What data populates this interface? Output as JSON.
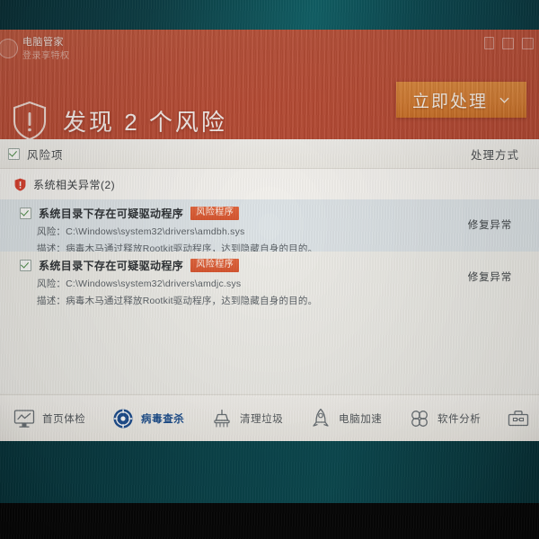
{
  "window": {
    "brand_name": "电脑管家",
    "brand_sub": "登录享特权",
    "controls": [
      "minimize-icon",
      "maximize-icon",
      "close-icon"
    ]
  },
  "header": {
    "shield_icon": "shield-warning-icon",
    "alert_title": "发现 2 个风险",
    "action_button": {
      "label": "立即处理",
      "dropdown_icon": "chevron-down-icon",
      "color": "#d97f33"
    },
    "background_color": "#bd4e36"
  },
  "list_header": {
    "select_all_checked": true,
    "left_label": "风险项",
    "right_label": "处理方式"
  },
  "group": {
    "icon": "shield-alert-icon",
    "label": "系统相关异常(2)",
    "count": 2
  },
  "risks": [
    {
      "checked": true,
      "name": "系统目录下存在可疑驱动程序",
      "badge": "风险程序",
      "badge_color": "#d8552f",
      "risk_line": "风险：C:\\Windows\\system32\\drivers\\amdbh.sys",
      "desc_line": "描述：病毒木马通过释放Rootkit驱动程序，达到隐藏自身的目的。",
      "action": "修复异常"
    },
    {
      "checked": true,
      "name": "系统目录下存在可疑驱动程序",
      "badge": "风险程序",
      "badge_color": "#d8552f",
      "risk_line": "风险：C:\\Windows\\system32\\drivers\\amdjc.sys",
      "desc_line": "描述：病毒木马通过释放Rootkit驱动程序，达到隐藏自身的目的。",
      "action": "修复异常"
    }
  ],
  "bottom_nav": [
    {
      "icon": "monitor-chart-icon",
      "label": "首页体检",
      "active": false
    },
    {
      "icon": "virus-scan-icon",
      "label": "病毒查杀",
      "active": true
    },
    {
      "icon": "broom-icon",
      "label": "清理垃圾",
      "active": false
    },
    {
      "icon": "rocket-icon",
      "label": "电脑加速",
      "active": false
    },
    {
      "icon": "clover-icon",
      "label": "软件分析",
      "active": false
    },
    {
      "icon": "toolbox-icon",
      "label": "",
      "active": false
    }
  ]
}
